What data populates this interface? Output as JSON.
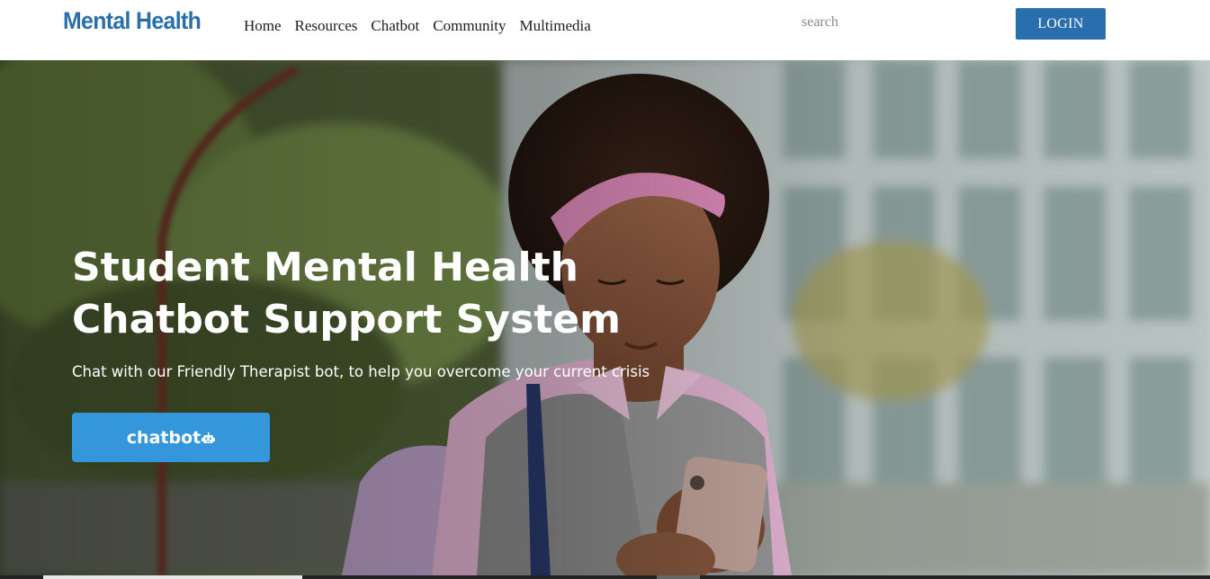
{
  "brand": {
    "name": "Mental Health",
    "color": "#2a6fa8"
  },
  "nav": {
    "links": [
      "Home",
      "Resources",
      "Chatbot",
      "Community",
      "Multimedia"
    ]
  },
  "search": {
    "placeholder": "search",
    "value": ""
  },
  "login": {
    "label": "LOGIN",
    "color": "#2a6fad"
  },
  "hero": {
    "title_line1": "Student Mental Health",
    "title_line2": "Chatbot Support System",
    "subtitle": "Chat with our Friendly Therapist bot, to help you overcome your current crisis",
    "cta_label": "chatbot",
    "cta_icon": "robot-icon",
    "cta_color": "#3497db",
    "background_image": "hero-photo-student-with-phone"
  }
}
